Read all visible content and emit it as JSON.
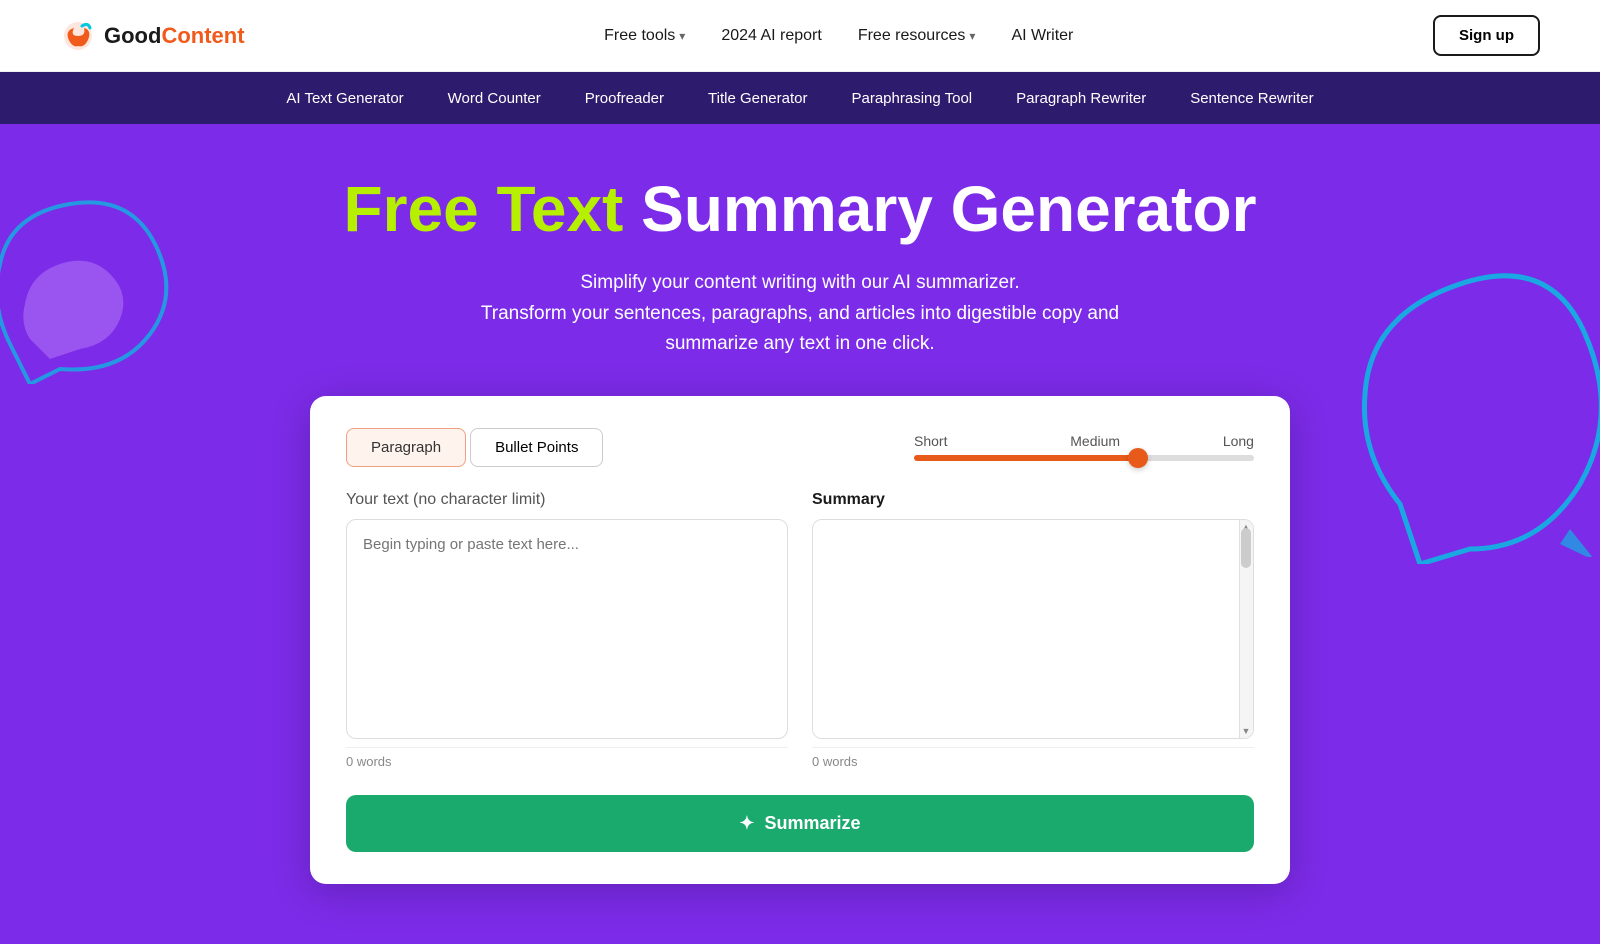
{
  "logo": {
    "good": "Good",
    "content": "Content"
  },
  "topnav": {
    "items": [
      {
        "label": "Free tools",
        "has_chevron": true
      },
      {
        "label": "2024 AI report",
        "has_chevron": false
      },
      {
        "label": "Free resources",
        "has_chevron": true
      },
      {
        "label": "AI Writer",
        "has_chevron": false
      }
    ],
    "signup": "Sign up"
  },
  "subnav": {
    "items": [
      "AI Text Generator",
      "Word Counter",
      "Proofreader",
      "Title Generator",
      "Paraphrasing Tool",
      "Paragraph Rewriter",
      "Sentence Rewriter"
    ]
  },
  "hero": {
    "title_highlight": "Free Text",
    "title_rest": " Summary Generator",
    "subtitle_line1": "Simplify your content writing with our AI summarizer.",
    "subtitle_line2": "Transform your sentences, paragraphs, and articles into digestible copy and summarize any text in one click."
  },
  "tool": {
    "tabs": [
      {
        "label": "Paragraph",
        "active": true
      },
      {
        "label": "Bullet Points",
        "active": false
      }
    ],
    "slider": {
      "short": "Short",
      "medium": "Medium",
      "long": "Long"
    },
    "input_label": "Your text",
    "input_sublabel": "(no character limit)",
    "input_placeholder": "Begin typing or paste text here...",
    "input_word_count": "0 words",
    "summary_label": "Summary",
    "summary_word_count": "0 words",
    "summarize_button": "Summarize"
  }
}
